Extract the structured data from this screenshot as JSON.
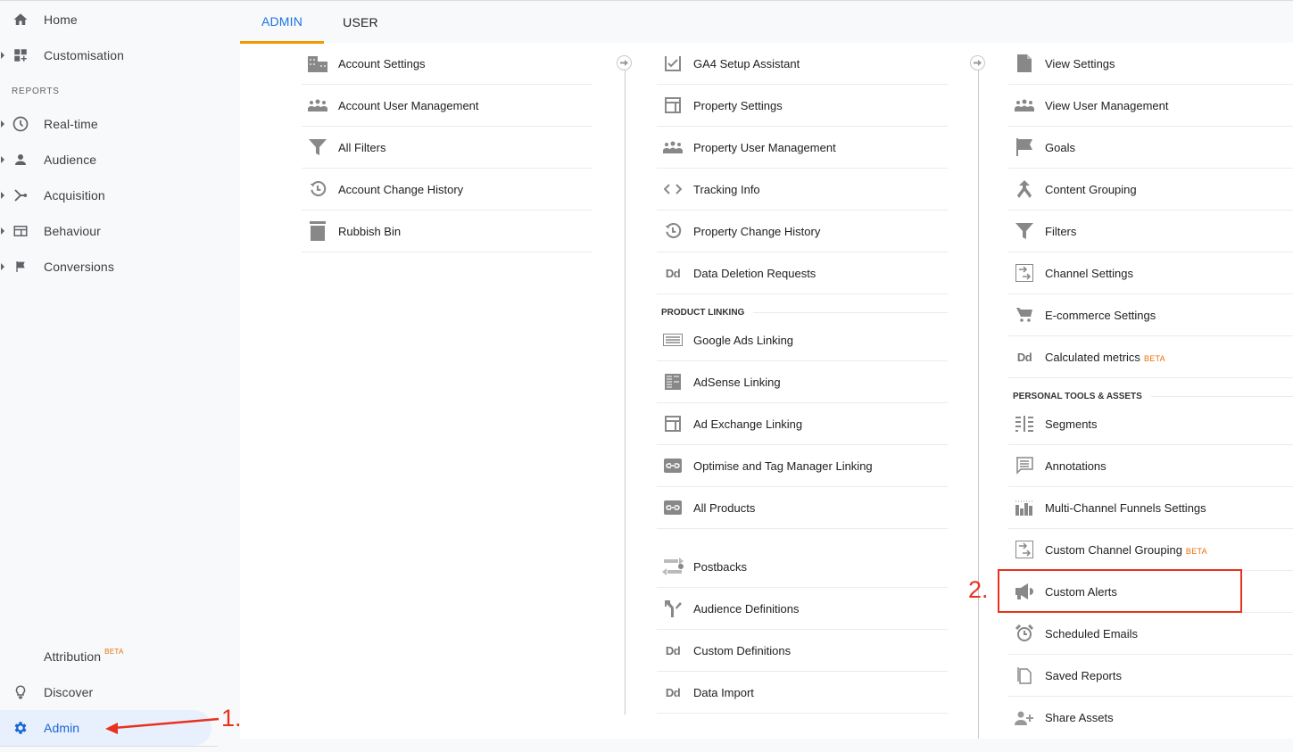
{
  "sidebar": {
    "home": "Home",
    "customisation": "Customisation",
    "reports_header": "REPORTS",
    "realtime": "Real-time",
    "audience": "Audience",
    "acquisition": "Acquisition",
    "behaviour": "Behaviour",
    "conversions": "Conversions",
    "attribution": "Attribution",
    "attribution_badge": "BETA",
    "discover": "Discover",
    "admin": "Admin"
  },
  "tabs": {
    "admin": "ADMIN",
    "user": "USER",
    "active": "ADMIN"
  },
  "account_column": {
    "items": [
      {
        "label": "Account Settings",
        "icon": "building-icon"
      },
      {
        "label": "Account User Management",
        "icon": "people-icon"
      },
      {
        "label": "All Filters",
        "icon": "filter-icon"
      },
      {
        "label": "Account Change History",
        "icon": "history-icon"
      },
      {
        "label": "Rubbish Bin",
        "icon": "trash-icon"
      }
    ]
  },
  "property_column": {
    "items": [
      {
        "label": "GA4 Setup Assistant",
        "icon": "checkbox-icon"
      },
      {
        "label": "Property Settings",
        "icon": "layout-icon"
      },
      {
        "label": "Property User Management",
        "icon": "people-icon"
      },
      {
        "label": "Tracking Info",
        "icon": "code-icon"
      },
      {
        "label": "Property Change History",
        "icon": "history-icon"
      },
      {
        "label": "Data Deletion Requests",
        "icon": "dd-icon"
      }
    ],
    "product_linking_header": "PRODUCT LINKING",
    "linking_items": [
      {
        "label": "Google Ads Linking",
        "icon": "ads-icon"
      },
      {
        "label": "AdSense Linking",
        "icon": "adsense-icon"
      },
      {
        "label": "Ad Exchange Linking",
        "icon": "layout-icon"
      },
      {
        "label": "Optimise and Tag Manager Linking",
        "icon": "link-icon"
      },
      {
        "label": "All Products",
        "icon": "link-icon"
      }
    ],
    "other_items": [
      {
        "label": "Postbacks",
        "icon": "postbacks-icon"
      },
      {
        "label": "Audience Definitions",
        "icon": "fork-icon"
      },
      {
        "label": "Custom Definitions",
        "icon": "dd-icon"
      },
      {
        "label": "Data Import",
        "icon": "dd-icon"
      }
    ]
  },
  "view_column": {
    "items": [
      {
        "label": "View Settings",
        "icon": "document-icon"
      },
      {
        "label": "View User Management",
        "icon": "people-icon"
      },
      {
        "label": "Goals",
        "icon": "flag-icon"
      },
      {
        "label": "Content Grouping",
        "icon": "merge-icon"
      },
      {
        "label": "Filters",
        "icon": "filter-icon"
      },
      {
        "label": "Channel Settings",
        "icon": "channel-icon"
      },
      {
        "label": "E-commerce Settings",
        "icon": "cart-icon"
      },
      {
        "label": "Calculated metrics",
        "badge": "BETA",
        "icon": "dd-icon"
      }
    ],
    "personal_header": "PERSONAL TOOLS & ASSETS",
    "personal_items": [
      {
        "label": "Segments",
        "icon": "segments-icon"
      },
      {
        "label": "Annotations",
        "icon": "comment-icon"
      },
      {
        "label": "Multi-Channel Funnels Settings",
        "icon": "bar-chart-icon"
      },
      {
        "label": "Custom Channel Grouping",
        "badge": "BETA",
        "icon": "channel-icon"
      },
      {
        "label": "Custom Alerts",
        "icon": "megaphone-icon"
      },
      {
        "label": "Scheduled Emails",
        "icon": "alarm-icon"
      },
      {
        "label": "Saved Reports",
        "icon": "copy-icon"
      },
      {
        "label": "Share Assets",
        "icon": "person-add-icon"
      }
    ]
  },
  "annotations": {
    "step1": "1.",
    "step2": "2.",
    "color": "#e8321e"
  }
}
